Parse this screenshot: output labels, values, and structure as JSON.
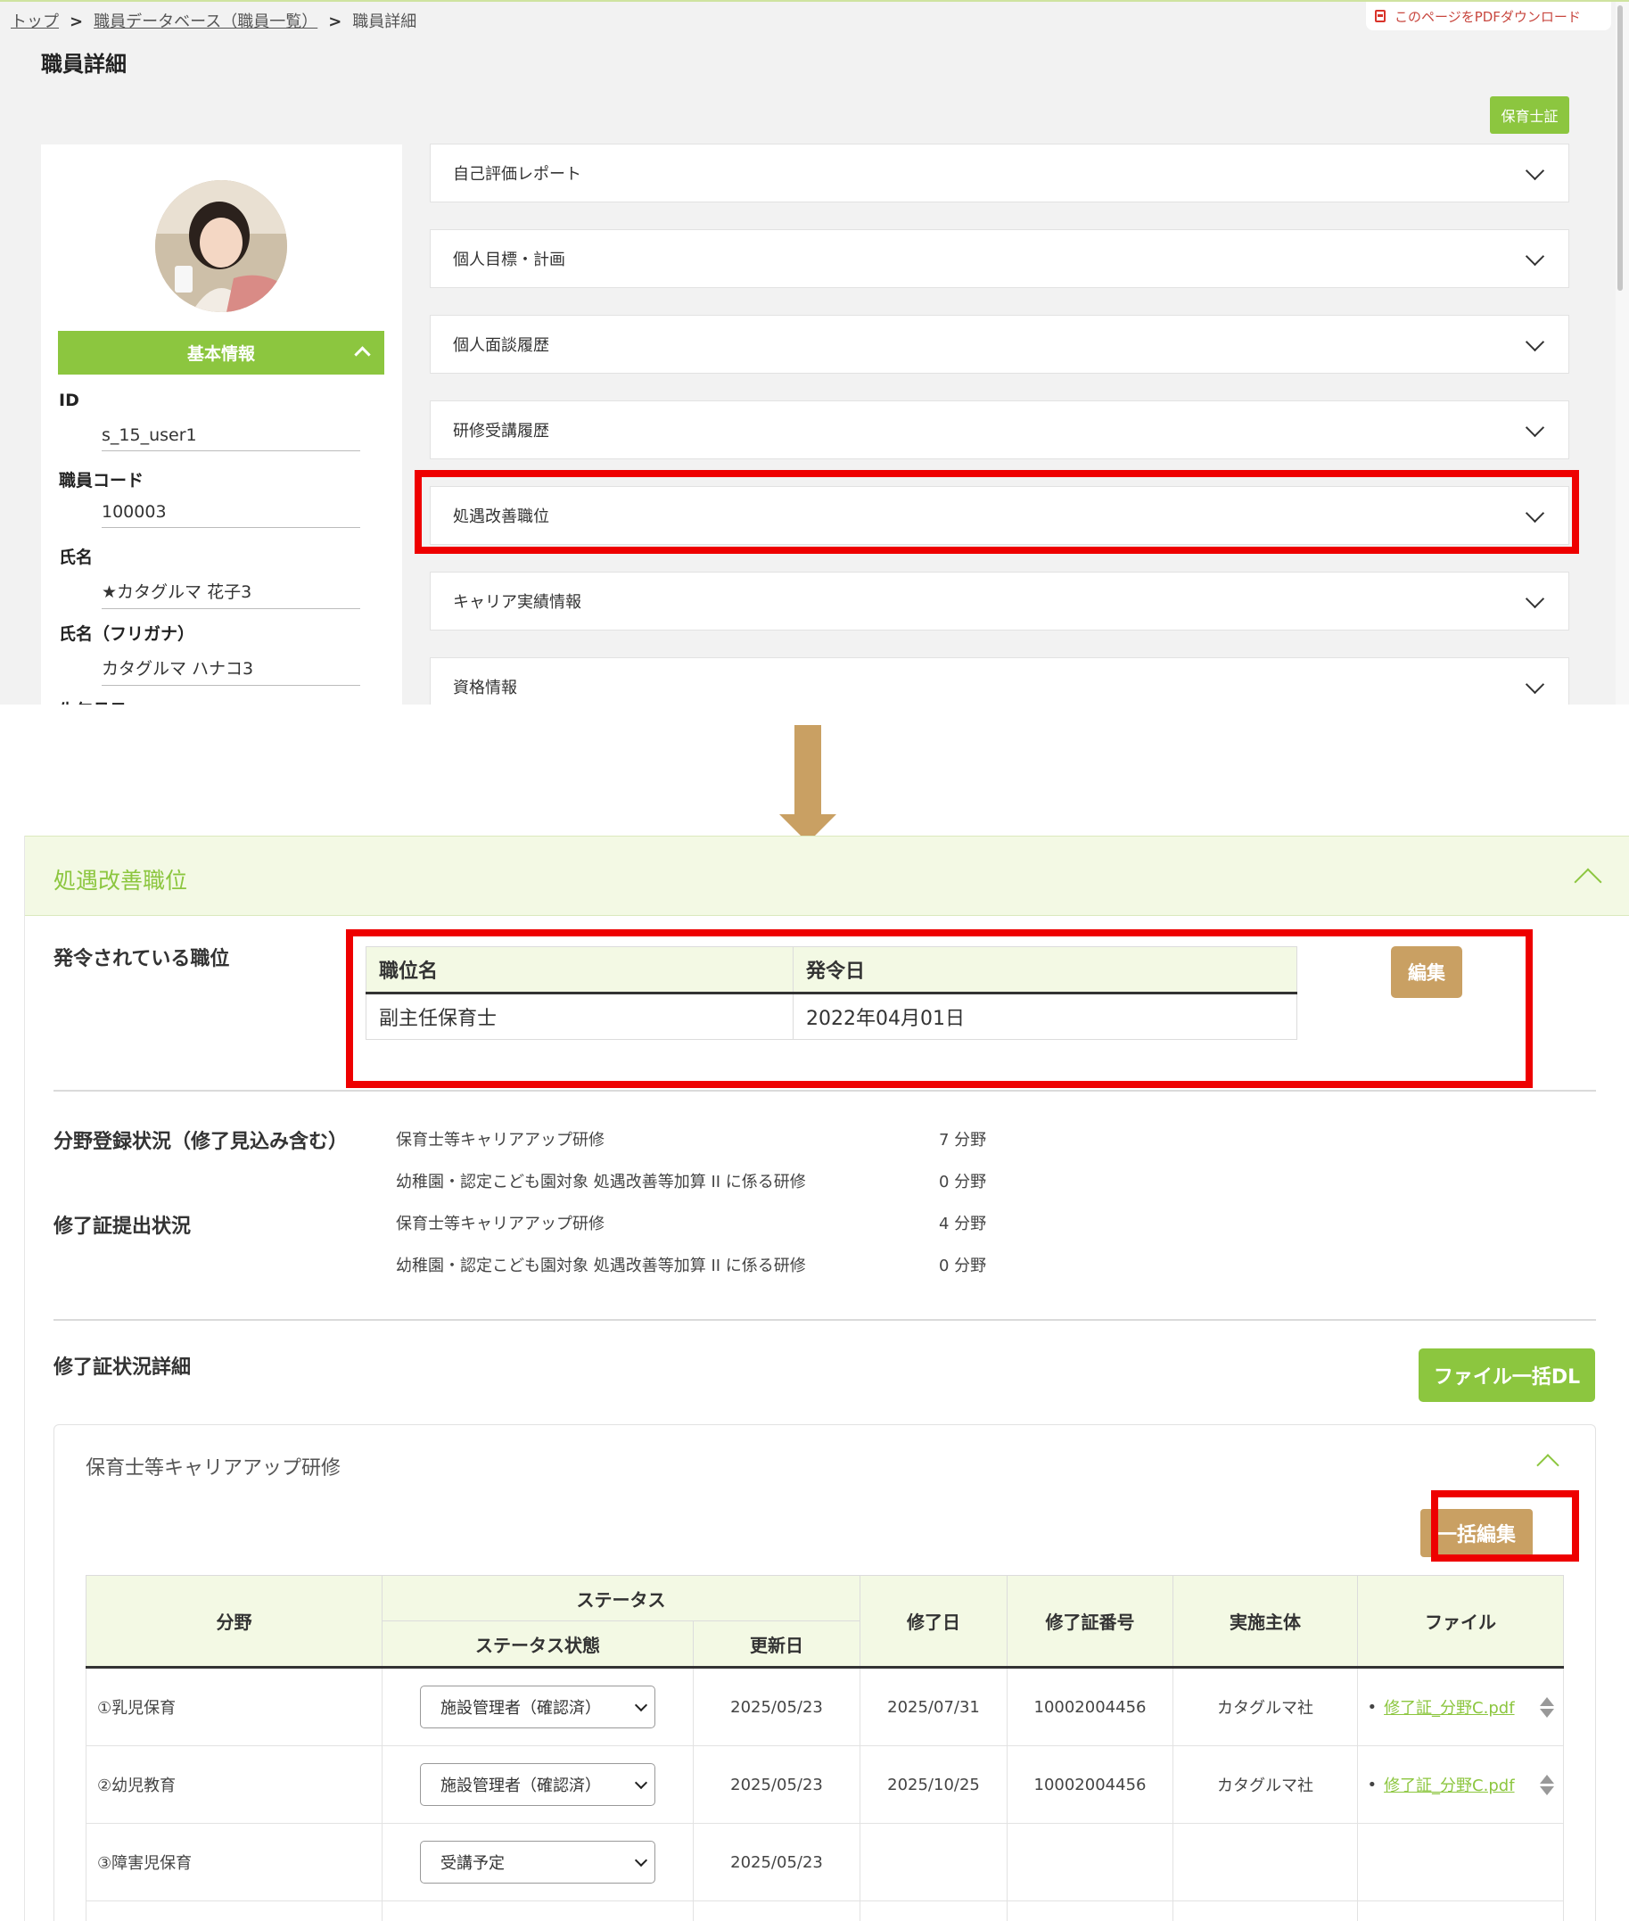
{
  "top": {
    "breadcrumb": [
      "トップ",
      "職員データベース（職員一覧）",
      "職員詳細"
    ],
    "pdf_download": "このページをPDFダウンロード",
    "page_title": "職員詳細",
    "cert_button": "保育士証",
    "basic_info": "基本情報",
    "fields": [
      {
        "label": "ID",
        "value": "s_15_user1"
      },
      {
        "label": "職員コード",
        "value": "100003"
      },
      {
        "label": "氏名",
        "value": "★カタグルマ 花子3"
      },
      {
        "label": "氏名（フリガナ）",
        "value": "カタグルマ ハナコ3"
      }
    ],
    "next_label": "生年月日",
    "accordion": [
      "自己評価レポート",
      "個人目標・計画",
      "個人面談履歴",
      "研修受講履歴",
      "処遇改善職位",
      "キャリア実績情報",
      "資格情報"
    ]
  },
  "bottom": {
    "section_title": "処遇改善職位",
    "assigned_label": "発令されている職位",
    "position_table": {
      "headers": [
        "職位名",
        "発令日"
      ],
      "rows": [
        [
          "副主任保育士",
          "2022年04月01日"
        ]
      ]
    },
    "edit_button": "編集",
    "registration_label": "分野登録状況（修了見込み含む）",
    "submission_label": "修了証提出状況",
    "registration_stats": [
      {
        "name": "保育士等キャリアアップ研修",
        "count": "7 分野"
      },
      {
        "name": "幼稚園・認定こども園対象 処遇改善等加算 II に係る研修",
        "count": "0 分野"
      }
    ],
    "submission_stats": [
      {
        "name": "保育士等キャリアアップ研修",
        "count": "4 分野"
      },
      {
        "name": "幼稚園・認定こども園対象 処遇改善等加算 II に係る研修",
        "count": "0 分野"
      }
    ],
    "details_label": "修了証状況詳細",
    "bulk_download": "ファイル一括DL",
    "panel_title": "保育士等キャリアアップ研修",
    "bulk_edit": "一括編集",
    "table_headers": {
      "field": "分野",
      "status": "ステータス",
      "status_state": "ステータス状態",
      "updated": "更新日",
      "completion_date": "修了日",
      "cert_number": "修了証番号",
      "organizer": "実施主体",
      "file": "ファイル"
    },
    "rows": [
      {
        "field": "①乳児保育",
        "status": "施設管理者（確認済）",
        "updated": "2025/05/23",
        "completion": "2025/07/31",
        "cert": "10002004456",
        "organizer": "カタグルマ社",
        "file": "修了証_分野C.pdf"
      },
      {
        "field": "②幼児教育",
        "status": "施設管理者（確認済）",
        "updated": "2025/05/23",
        "completion": "2025/10/25",
        "cert": "10002004456",
        "organizer": "カタグルマ社",
        "file": "修了証_分野C.pdf"
      },
      {
        "field": "③障害児保育",
        "status": "受講予定",
        "updated": "2025/05/23",
        "completion": "",
        "cert": "",
        "organizer": "",
        "file": ""
      }
    ]
  }
}
